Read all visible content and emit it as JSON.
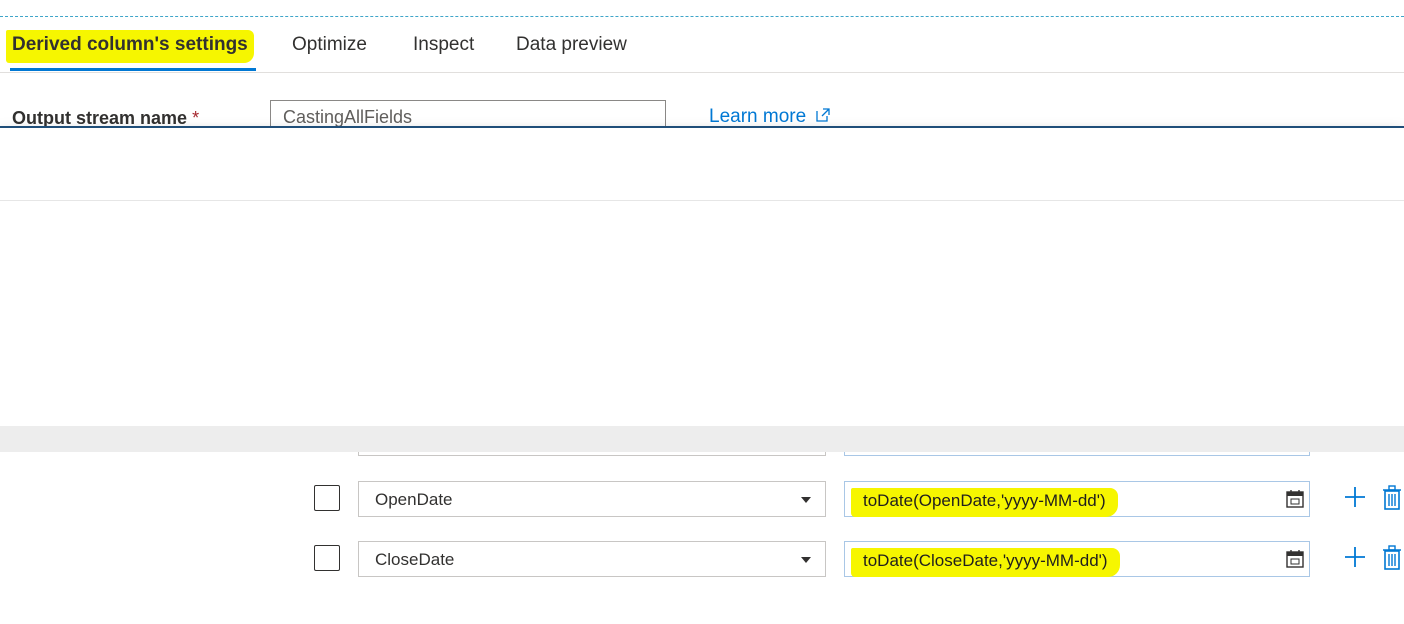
{
  "tabs": [
    {
      "label": "Derived column's settings",
      "active": true
    },
    {
      "label": "Optimize"
    },
    {
      "label": "Inspect"
    },
    {
      "label": "Data preview"
    }
  ],
  "output_stream": {
    "label": "Output stream name",
    "required_marker": "*",
    "value": "CastingAllFields",
    "learn_more": "Learn more"
  },
  "columns": [
    {
      "name": "OpenDate",
      "expression": "toDate(OpenDate,'yyyy-MM-dd')"
    },
    {
      "name": "CloseDate",
      "expression": "toDate(CloseDate,'yyyy-MM-dd')"
    }
  ],
  "colors": {
    "accent": "#0078d4",
    "highlight": "#f6f600"
  },
  "icons": [
    "calendar-icon",
    "plus-icon",
    "trash-icon",
    "external-link-icon",
    "chevron-down-icon"
  ]
}
